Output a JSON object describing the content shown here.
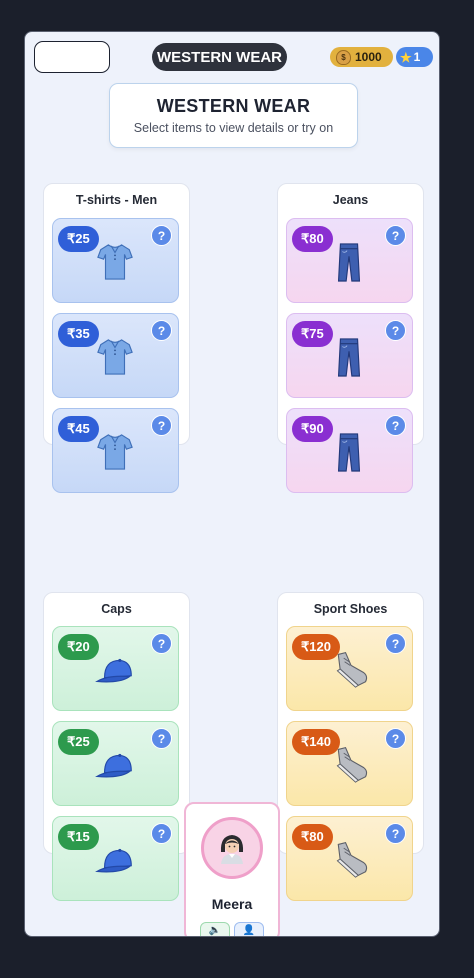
{
  "header": {
    "title": "WESTERN WEAR",
    "coins": "1000",
    "stars": "1"
  },
  "intro": {
    "title": "WESTERN WEAR",
    "subtitle": "Select items to view details or try on"
  },
  "categories": [
    {
      "name": "T-shirts - Men",
      "color": "#2f5fd8",
      "icon": "tshirt-icon",
      "items": [
        {
          "price": "₹25"
        },
        {
          "price": "₹35"
        },
        {
          "price": "₹45"
        }
      ]
    },
    {
      "name": "Jeans",
      "color": "#8a2fd1",
      "icon": "jeans-icon",
      "items": [
        {
          "price": "₹80"
        },
        {
          "price": "₹75"
        },
        {
          "price": "₹90"
        }
      ]
    },
    {
      "name": "Caps",
      "color": "#2d9a4d",
      "icon": "cap-icon",
      "items": [
        {
          "price": "₹20"
        },
        {
          "price": "₹25"
        },
        {
          "price": "₹15"
        }
      ]
    },
    {
      "name": "Sport Shoes",
      "color": "#d85a16",
      "icon": "shoe-icon",
      "items": [
        {
          "price": "₹120"
        },
        {
          "price": "₹140"
        },
        {
          "price": "₹80"
        }
      ]
    }
  ],
  "character": {
    "name": "Meera",
    "icon": "woman-avatar-icon"
  },
  "info_icon": "question-icon",
  "info_glyph": "?"
}
